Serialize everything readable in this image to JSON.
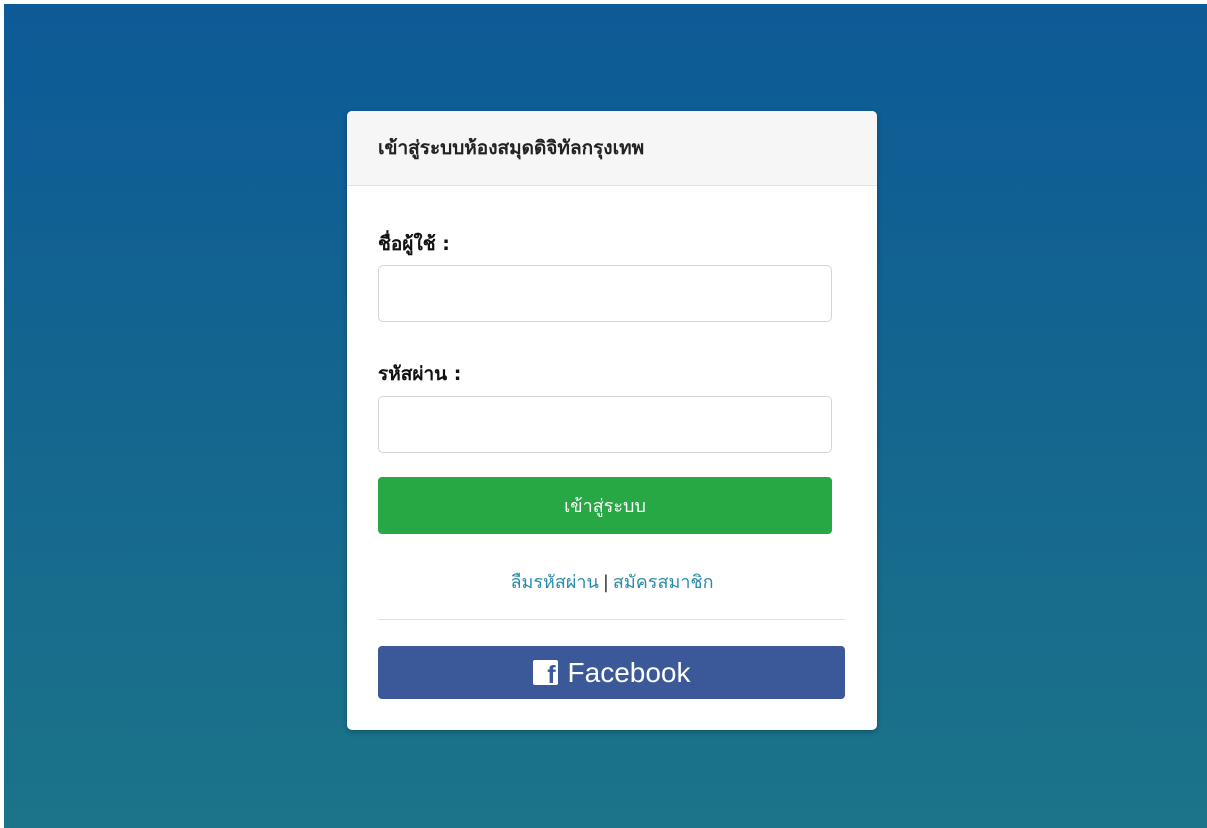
{
  "header": {
    "title": "เข้าสู่ระบบห้องสมุดดิจิทัลกรุงเทพ"
  },
  "form": {
    "username_label": "ชื่อผู้ใช้ :",
    "username_value": "",
    "password_label": "รหัสผ่าน :",
    "password_value": "",
    "login_label": "เข้าสู่ระบบ"
  },
  "links": {
    "forgot_password": "ลืมรหัสผ่าน",
    "separator": "|",
    "register": "สมัครสมาชิก"
  },
  "social": {
    "facebook_label": "Facebook",
    "facebook_icon_glyph": "f",
    "facebook_color": "#3b5998"
  },
  "colors": {
    "login_button": "#28a745",
    "link": "#2a8aa8",
    "background_top": "#0d5a97",
    "background_bottom": "#1b7489"
  }
}
